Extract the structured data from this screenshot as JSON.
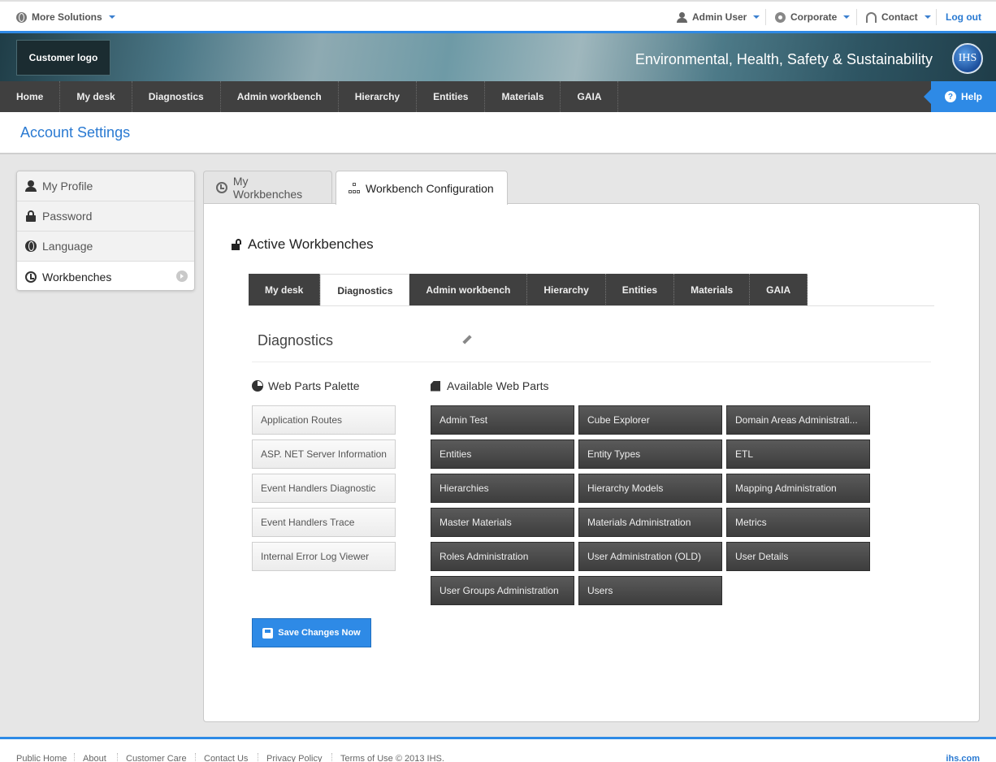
{
  "topbar": {
    "more_solutions": "More Solutions",
    "admin_user": "Admin User",
    "corporate": "Corporate",
    "contact": "Contact",
    "logout": "Log out"
  },
  "banner": {
    "customer_logo": "Customer logo",
    "title": "Environmental, Health, Safety & Sustainability",
    "brand": "IHS"
  },
  "mainnav": {
    "items": [
      "Home",
      "My desk",
      "Diagnostics",
      "Admin workbench",
      "Hierarchy",
      "Entities",
      "Materials",
      "GAIA"
    ],
    "help": "Help"
  },
  "page": {
    "title": "Account Settings"
  },
  "sidemenu": {
    "items": [
      "My Profile",
      "Password",
      "Language",
      "Workbenches"
    ],
    "active": "Workbenches"
  },
  "tabs": {
    "my_workbenches": "My Workbenches",
    "workbench_config": "Workbench Configuration"
  },
  "config": {
    "section_title": "Active Workbenches",
    "workbench_tabs": [
      "My desk",
      "Diagnostics",
      "Admin workbench",
      "Hierarchy",
      "Entities",
      "Materials",
      "GAIA"
    ],
    "active_workbench": "Diagnostics",
    "workbench_name": "Diagnostics",
    "palette_title": "Web Parts Palette",
    "palette": [
      "Application Routes",
      "ASP. NET Server Information",
      "Event Handlers Diagnostic",
      "Event Handlers Trace",
      "Internal Error Log Viewer"
    ],
    "available_title": "Available Web Parts",
    "available": [
      "Admin Test",
      "Cube Explorer",
      "Domain Areas Administrati...",
      "Entities",
      "Entity Types",
      "ETL",
      "Hierarchies",
      "Hierarchy Models",
      "Mapping Administration",
      "Master Materials",
      "Materials Administration",
      "Metrics",
      "Roles Administration",
      "User Administration (OLD)",
      "User Details",
      "User Groups Administration",
      "Users"
    ],
    "save_label": "Save Changes Now"
  },
  "footer": {
    "links": [
      "Public Home",
      "About",
      "Customer Care",
      "Contact Us",
      "Privacy Policy",
      "Terms of Use © 2013 IHS."
    ],
    "site": "ihs.com"
  },
  "colors": {
    "accent": "#2e8ae6",
    "nav_bg": "#404040",
    "link": "#2a7ad2"
  }
}
